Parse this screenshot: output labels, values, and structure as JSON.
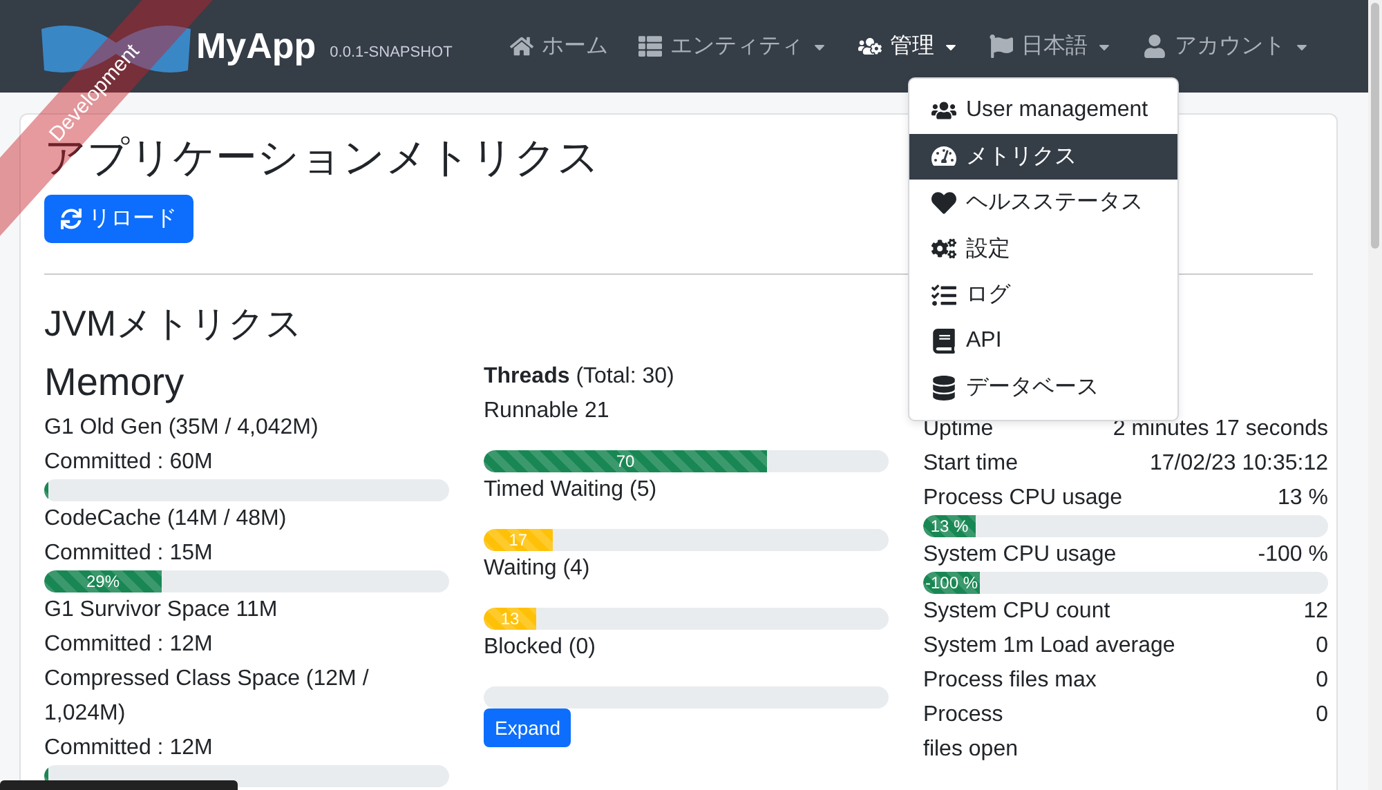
{
  "ribbon": {
    "text": "Development"
  },
  "navbar": {
    "brand": "MyApp",
    "version": "0.0.1-SNAPSHOT",
    "items": [
      {
        "label": "ホーム",
        "selected": false,
        "dropdown": false
      },
      {
        "label": "エンティティ",
        "selected": false,
        "dropdown": true
      },
      {
        "label": "管理",
        "selected": true,
        "dropdown": true
      },
      {
        "label": "日本語",
        "selected": false,
        "dropdown": true
      },
      {
        "label": "アカウント",
        "selected": false,
        "dropdown": true
      }
    ]
  },
  "admin_menu": [
    {
      "label": "User management",
      "selected": false
    },
    {
      "label": "メトリクス",
      "selected": true
    },
    {
      "label": "ヘルスステータス",
      "selected": false
    },
    {
      "label": "設定",
      "selected": false
    },
    {
      "label": "ログ",
      "selected": false
    },
    {
      "label": "API",
      "selected": false
    },
    {
      "label": "データベース",
      "selected": false
    }
  ],
  "page": {
    "title": "アプリケーションメトリクス",
    "reload_button": "リロード",
    "section_title": "JVMメトリクス"
  },
  "memory": {
    "title": "Memory",
    "items": [
      {
        "name": "G1 Old Gen (35M / 4,042M)",
        "committed": "Committed : 60M",
        "bar": {
          "level": 0.01
        }
      },
      {
        "name": "CodeCache (14M / 48M)",
        "committed": "Committed : 15M",
        "bar": {
          "level": 0.29,
          "label": "29%"
        }
      },
      {
        "name": "G1 Survivor Space 11M",
        "committed": "Committed : 12M"
      },
      {
        "name": "Compressed Class Space (12M / 1,024M)",
        "committed": "Committed : 12M",
        "bar": {
          "level": 0.01
        }
      }
    ]
  },
  "threads": {
    "title": "Threads",
    "total": "(Total: 30)",
    "items": [
      {
        "label": "Runnable 21",
        "level": 0.7,
        "bar_label": "70",
        "color": "#198754"
      },
      {
        "label": "Timed Waiting (5)",
        "level": 0.17,
        "bar_label": "17",
        "color": "#ffc107"
      },
      {
        "label": "Waiting (4)",
        "level": 0.13,
        "bar_label": "13",
        "color": "#ffc107"
      },
      {
        "label": "Blocked (0)"
      }
    ],
    "expand_button": "Expand"
  },
  "system": [
    {
      "label": "Uptime",
      "value": "2 minutes 17 seconds"
    },
    {
      "label": "Start time",
      "value": "17/02/23 10:35:12"
    },
    {
      "label": "Process CPU usage",
      "value": "13 %",
      "bar": {
        "level": 0.13,
        "label": "13 %"
      }
    },
    {
      "label": "System CPU usage",
      "value": "-100 %",
      "bar": {
        "level": 0.14,
        "label": "-100 %"
      }
    },
    {
      "label": "System CPU count",
      "value": "12"
    },
    {
      "label": "System 1m Load average",
      "value": "0"
    },
    {
      "label": "Process files max",
      "value": "0"
    },
    {
      "label": "Process\nfiles open",
      "value": "0"
    }
  ]
}
